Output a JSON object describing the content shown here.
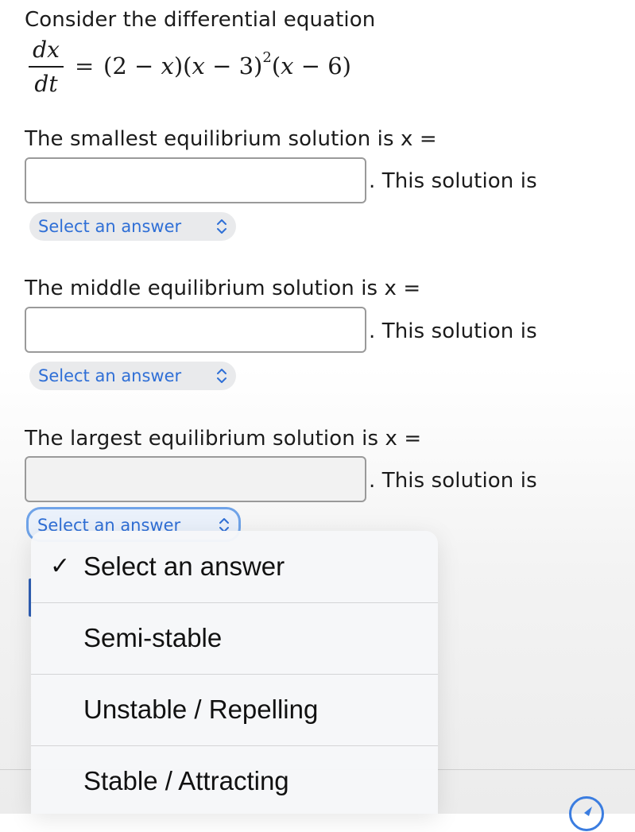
{
  "intro": "Consider the differential equation",
  "equation": {
    "numerator": "dx",
    "denominator": "dt",
    "equals": "=",
    "rhs_parts": [
      "(2 − ",
      "x",
      ")(",
      "x",
      " − 3)",
      "2",
      "(",
      "x",
      " − 6)"
    ]
  },
  "questions": [
    {
      "prompt": "The smallest equilibrium solution is x =",
      "suffix": ". This solution is",
      "value": "",
      "select_label": "Select an answer",
      "chevron": "⌃⌄"
    },
    {
      "prompt": "The middle equilibrium solution is x =",
      "suffix": ". This solution is",
      "value": "",
      "select_label": "Select an answer",
      "chevron": "⌃⌄"
    },
    {
      "prompt": "The largest equilibrium solution is x =",
      "suffix": ". This solution is",
      "value": "",
      "select_label": "Select an answer",
      "chevron": "⌃⌄"
    }
  ],
  "dropdown": {
    "selected_mark": "✓",
    "options": [
      "Select an answer",
      "Semi-stable",
      "Unstable / Repelling",
      "Stable / Attracting"
    ]
  },
  "colors": {
    "accent": "#2f6fd6",
    "focus_ring": "#6fa3e8"
  },
  "icons": {
    "chevron": "chevron-up-down-icon",
    "check": "checkmark-icon",
    "compass": "compass-icon"
  }
}
